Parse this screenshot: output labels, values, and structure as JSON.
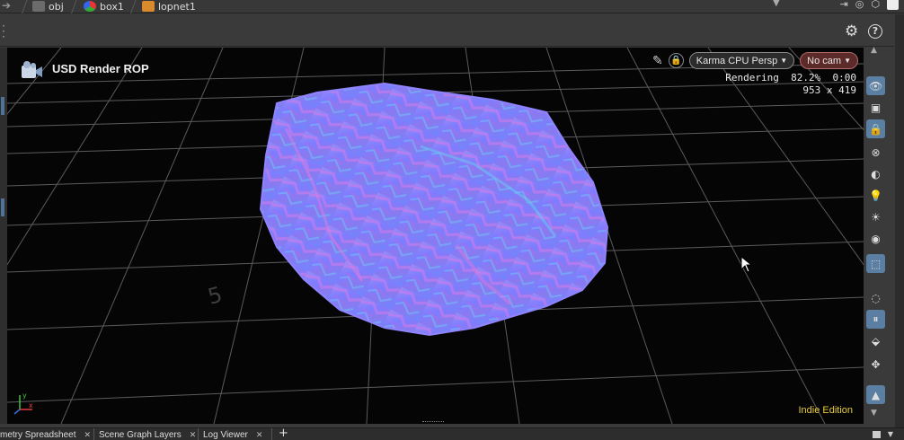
{
  "pathbar": {
    "crumbs": [
      "obj",
      "box1",
      "lopnet1"
    ]
  },
  "viewport": {
    "title": "USD Render ROP",
    "renderer_label": "Karma CPU  Persp",
    "camera_label": "No cam",
    "status_line1": "Rendering  82.2%  0:00",
    "status_line2": "953 x 419",
    "edition": "Indie Edition",
    "grid_label": "5",
    "axis_x": "x",
    "axis_y": "y",
    "colors": {
      "edition": "#e9cf3c",
      "nocam_bg": "#5d2a2a",
      "accent": "#5b7fa3"
    }
  },
  "toolbar": {
    "help": "?"
  },
  "tabs": [
    {
      "label": "metry Spreadsheet"
    },
    {
      "label": "Scene Graph Layers"
    },
    {
      "label": "Log Viewer"
    }
  ],
  "icons": {
    "rightbar": [
      "display-options-icon",
      "snapshot-icon",
      "lock-icon",
      "ghost-icon",
      "shading-icon",
      "light-icon",
      "headlight-icon",
      "camera-light-icon",
      "render-region-icon",
      "visibility-icon",
      "pause-icon",
      "select-icon",
      "transform-icon",
      "background-icon"
    ]
  }
}
